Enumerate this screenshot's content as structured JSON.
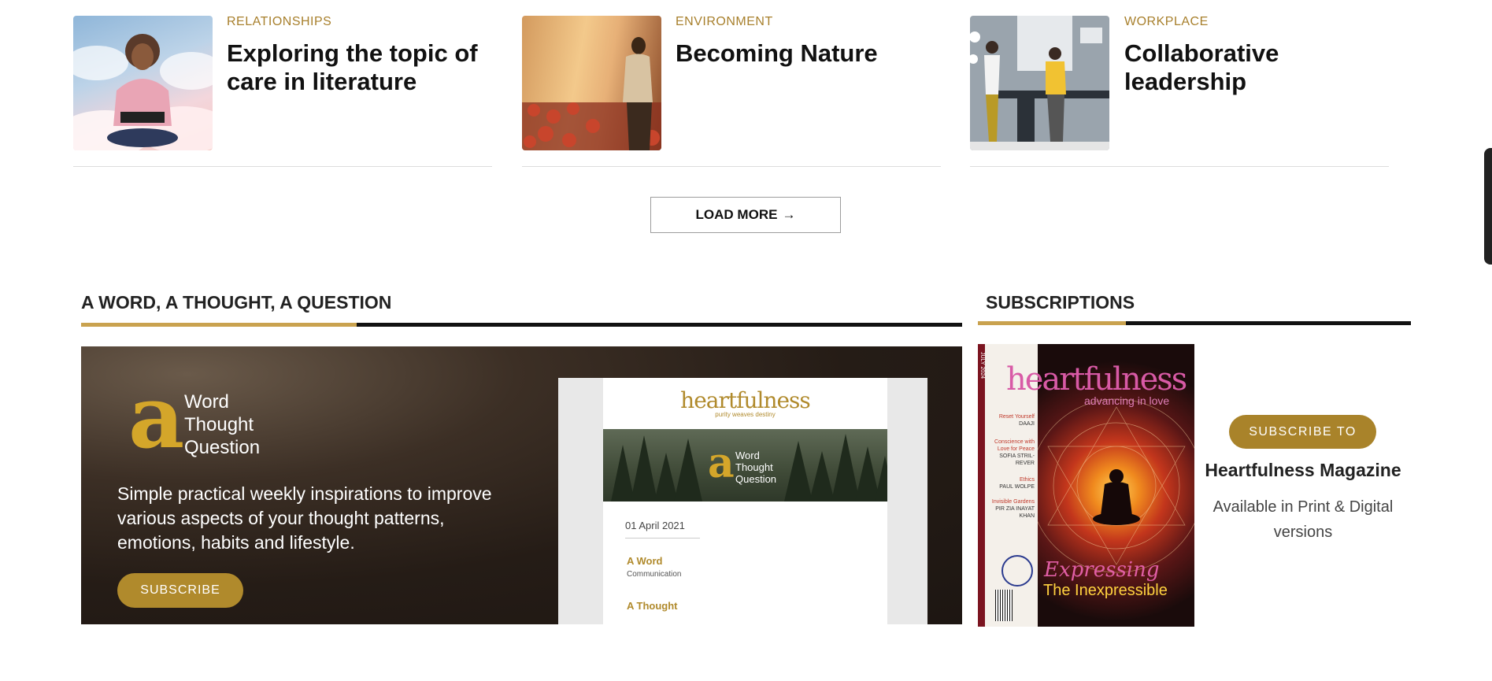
{
  "articles": [
    {
      "category": "RELATIONSHIPS",
      "title": "Exploring the topic of care in literature",
      "image": "woman-reading-book-in-clouds"
    },
    {
      "category": "ENVIRONMENT",
      "title": "Becoming Nature",
      "image": "man-in-flower-field"
    },
    {
      "category": "WORKPLACE",
      "title": "Collaborative leadership",
      "image": "office-team-illustration"
    }
  ],
  "load_more": {
    "label": "LOAD MORE",
    "icon": "arrow-right-icon"
  },
  "wtq_section": {
    "title": "A WORD, A THOUGHT, A QUESTION",
    "logo_letter": "a",
    "logo_words": [
      "Word",
      "Thought",
      "Question"
    ],
    "description": "Simple practical weekly inspirations to improve various aspects of your thought patterns, emotions, habits and lifestyle.",
    "subscribe_label": "SUBSCRIBE",
    "preview": {
      "brand": "heartfulness",
      "tagline": "purity weaves destiny",
      "logo_letter": "a",
      "logo_words": [
        "Word",
        "Thought",
        "Question"
      ],
      "date": "01 April 2021",
      "items": [
        {
          "heading": "A Word",
          "sub": "Communication"
        },
        {
          "heading": "A Thought",
          "sub": ""
        }
      ]
    }
  },
  "subscriptions": {
    "title": "SUBSCRIPTIONS",
    "magazine_cover": {
      "issue": "JULY 2024",
      "title": "heartfulness",
      "tagline": "advancing in love",
      "toc": [
        {
          "title": "Reset Yourself",
          "author": "DAAJI"
        },
        {
          "title": "Conscience with Love for Peace",
          "author": "SOFIA STRIL-REVER"
        },
        {
          "title": "Ethics",
          "author": "PAUL WOLPE"
        },
        {
          "title": "Invisible Gardens",
          "author": "PIR ZIA INAYAT KHAN"
        }
      ],
      "headline_1": "Expressing",
      "headline_2": "The Inexpressible"
    },
    "subscribe_label": "SUBSCRIBE TO",
    "magazine_name": "Heartfulness Magazine",
    "availability": "Available in Print & Digital versions"
  },
  "colors": {
    "gold": "#c9a24f",
    "button_gold": "#b08a2c",
    "category": "#a8802d"
  }
}
